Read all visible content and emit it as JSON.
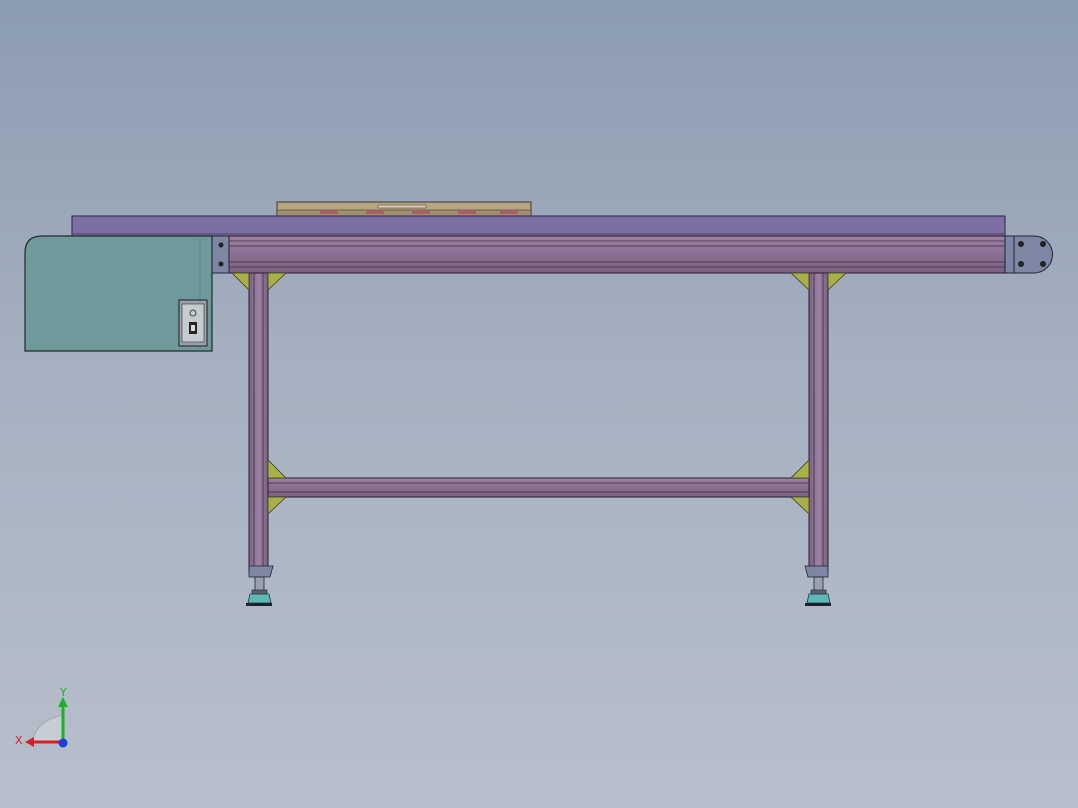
{
  "colors": {
    "background_top": "#8c9cb0",
    "background_bottom": "#b8bfcc",
    "frame_profile": "#8f7495",
    "belt": "#7d6fa3",
    "motor_housing": "#6e9a9c",
    "gusset": "#a8b04a",
    "leveling_foot": "#5fb8b5",
    "end_plate": "#7d86a3",
    "payload_tray": "#b8a680",
    "axis_x": "#d61f26",
    "axis_y": "#1fb02a",
    "axis_z": "#1e3fd6"
  },
  "axes": {
    "x_label": "X",
    "y_label": "Y"
  },
  "icons": {
    "triad": "coordinate-triad-icon",
    "switch": "power-switch-icon"
  }
}
